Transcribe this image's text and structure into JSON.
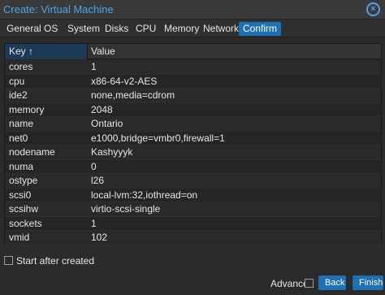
{
  "window": {
    "title": "Create: Virtual Machine",
    "close_icon": "close-icon"
  },
  "tabs": [
    {
      "label": "General"
    },
    {
      "label": "OS"
    },
    {
      "label": "System"
    },
    {
      "label": "Disks"
    },
    {
      "label": "CPU"
    },
    {
      "label": "Memory"
    },
    {
      "label": "Network"
    },
    {
      "label": "Confirm",
      "active": true
    }
  ],
  "grid": {
    "header_key": "Key ↑",
    "header_value": "Value",
    "rows": [
      {
        "key": "cores",
        "value": "1"
      },
      {
        "key": "cpu",
        "value": "x86-64-v2-AES"
      },
      {
        "key": "ide2",
        "value": "none,media=cdrom"
      },
      {
        "key": "memory",
        "value": "2048"
      },
      {
        "key": "name",
        "value": "Ontario"
      },
      {
        "key": "net0",
        "value": "e1000,bridge=vmbr0,firewall=1"
      },
      {
        "key": "nodename",
        "value": "Kashyyyk"
      },
      {
        "key": "numa",
        "value": "0"
      },
      {
        "key": "ostype",
        "value": "l26"
      },
      {
        "key": "scsi0",
        "value": "local-lvm:32,iothread=on"
      },
      {
        "key": "scsihw",
        "value": "virtio-scsi-single"
      },
      {
        "key": "sockets",
        "value": "1"
      },
      {
        "key": "vmid",
        "value": "102"
      }
    ]
  },
  "start_after_created": {
    "label": "Start after created",
    "checked": false
  },
  "footer": {
    "advanced_label": "Advanced",
    "advanced_checked": false,
    "back_label": "Back",
    "finish_label": "Finish"
  }
}
